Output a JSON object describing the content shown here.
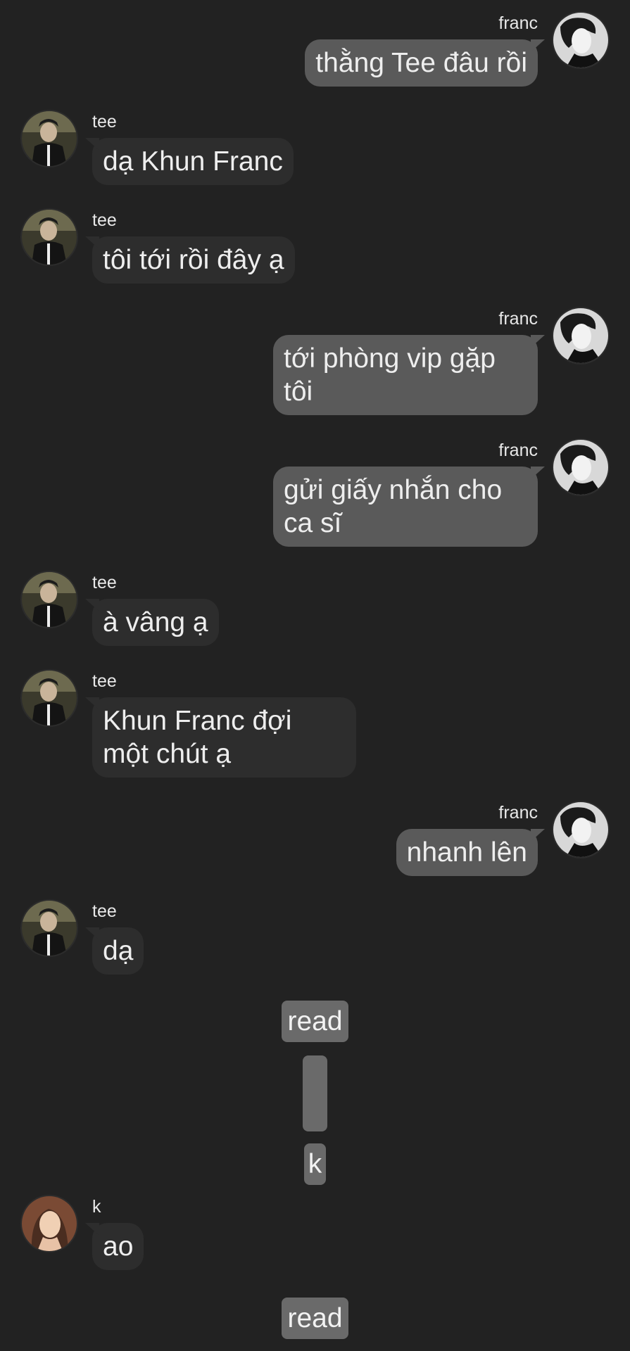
{
  "participants": {
    "franc": {
      "name": "franc",
      "side": "right",
      "avatar": "franc-avatar-icon"
    },
    "tee": {
      "name": "tee",
      "side": "left",
      "avatar": "tee-avatar-icon"
    },
    "k": {
      "name": "k",
      "side": "left",
      "avatar": "k-avatar-icon"
    }
  },
  "messages": [
    {
      "sender": "franc",
      "text": "thằng Tee đâu rồi"
    },
    {
      "sender": "tee",
      "text": "dạ Khun Franc"
    },
    {
      "sender": "tee",
      "text": "tôi tới rồi đây ạ"
    },
    {
      "sender": "franc",
      "text": "tới phòng vip gặp\ntôi"
    },
    {
      "sender": "franc",
      "text": "gửi giấy nhắn cho\nca sĩ"
    },
    {
      "sender": "tee",
      "text": "à vâng ạ"
    },
    {
      "sender": "tee",
      "text": "Khun Franc đợi\nmột chút ạ"
    },
    {
      "sender": "franc",
      "text": "nhanh lên"
    },
    {
      "sender": "tee",
      "text": "dạ"
    }
  ],
  "system_notes": {
    "read_1": "read",
    "blank": "",
    "k_note": "k",
    "read_2": "read"
  },
  "k_message": {
    "sender": "k",
    "text": "ao"
  },
  "colors": {
    "background": "#222222",
    "left_bubble": "#2d2d2d",
    "right_bubble": "#5a5a5a",
    "system_pill": "#6a6a6a",
    "text": "#eeeeee"
  }
}
